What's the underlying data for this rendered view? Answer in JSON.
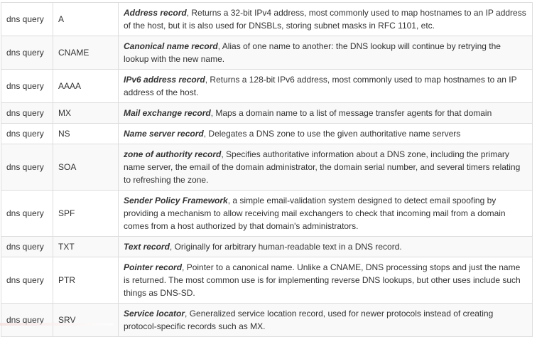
{
  "rows": [
    {
      "query": "dns query",
      "type": "A",
      "name": "Address record",
      "desc": ", Returns a 32-bit IPv4 address, most commonly used to map hostnames to an IP address of the host, but it is also used for DNSBLs, storing subnet masks in RFC 1101, etc."
    },
    {
      "query": "dns query",
      "type": "CNAME",
      "name": "Canonical name record",
      "desc": ", Alias of one name to another: the DNS lookup will continue by retrying the lookup with the new name."
    },
    {
      "query": "dns query",
      "type": "AAAA",
      "name": "IPv6 address record",
      "desc": ", Returns a 128-bit IPv6 address, most commonly used to map hostnames to an IP address of the host."
    },
    {
      "query": "dns query",
      "type": "MX",
      "name": "Mail exchange record",
      "desc": ", Maps a domain name to a list of message transfer agents for that domain"
    },
    {
      "query": "dns query",
      "type": "NS",
      "name": "Name server record",
      "desc": ", Delegates a DNS zone to use the given authoritative name servers"
    },
    {
      "query": "dns query",
      "type": "SOA",
      "name": "zone of authority record",
      "desc": ", Specifies authoritative information about a DNS zone, including the primary name server, the email of the domain administrator, the domain serial number, and several timers relating to refreshing the zone."
    },
    {
      "query": "dns query",
      "type": "SPF",
      "name": "Sender Policy Framework",
      "desc": ", a simple email-validation system designed to detect email spoofing by providing a mechanism to allow receiving mail exchangers to check that incoming mail from a domain comes from a host authorized by that domain's administrators."
    },
    {
      "query": "dns query",
      "type": "TXT",
      "name": "Text record",
      "desc": ", Originally for arbitrary human-readable text in a DNS record."
    },
    {
      "query": "dns query",
      "type": "PTR",
      "name": "Pointer record",
      "desc": ", Pointer to a canonical name. Unlike a CNAME, DNS processing stops and just the name is returned. The most common use is for implementing reverse DNS lookups, but other uses include such things as DNS-SD."
    },
    {
      "query": "dns query",
      "type": "SRV",
      "name": "Service locator",
      "desc": ", Generalized service location record, used for newer protocols instead of creating protocol-specific records such as MX."
    }
  ]
}
